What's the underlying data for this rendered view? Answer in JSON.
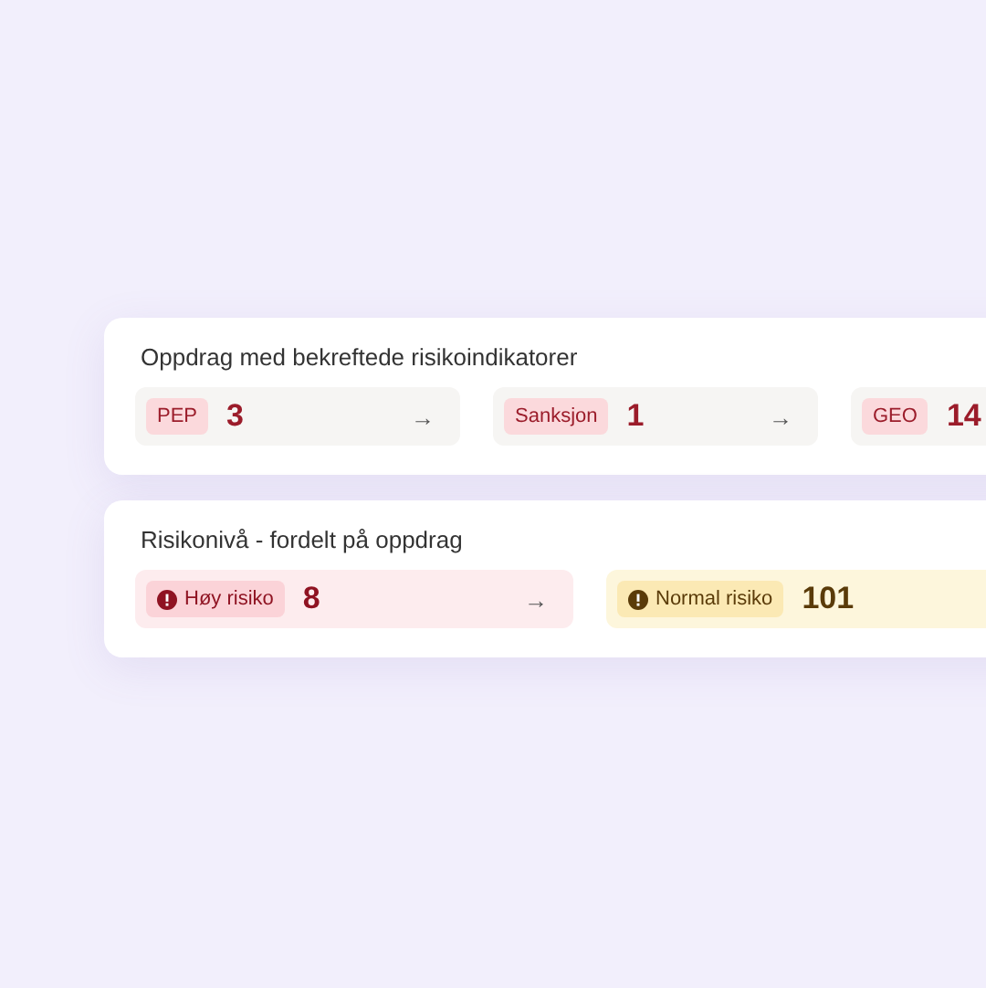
{
  "cards": [
    {
      "title": "Oppdrag med bekreftede risikoindikatorer",
      "tiles": [
        {
          "kind": "indicator",
          "label": "PEP",
          "count": "3",
          "arrow": "→"
        },
        {
          "kind": "indicator",
          "label": "Sanksjon",
          "count": "1",
          "arrow": "→"
        },
        {
          "kind": "indicator",
          "label": "GEO",
          "count": "14"
        }
      ]
    },
    {
      "title": "Risikonivå - fordelt på oppdrag",
      "tiles": [
        {
          "kind": "high",
          "label": "Høy risiko",
          "count": "8",
          "arrow": "→"
        },
        {
          "kind": "normal",
          "label": "Normal risiko",
          "count": "101"
        }
      ]
    }
  ]
}
